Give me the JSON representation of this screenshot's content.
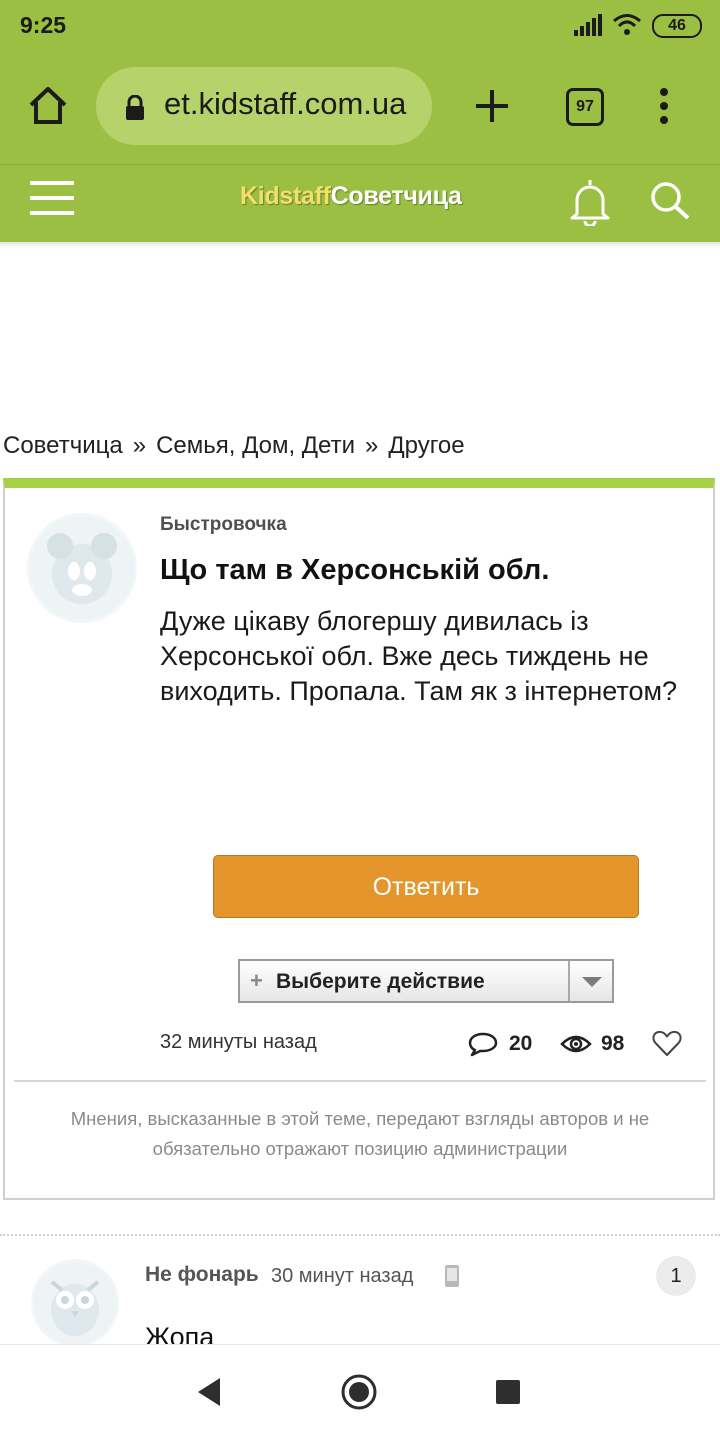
{
  "status_bar": {
    "time": "9:25",
    "battery": "46"
  },
  "browser": {
    "url": "et.kidstaff.com.ua",
    "tab_count": "97"
  },
  "site": {
    "logo_part1": "Kidstaff",
    "logo_part2": "Советчица"
  },
  "breadcrumb": {
    "items": [
      "Советчица",
      "Семья, Дом, Дети",
      "Другое"
    ],
    "separator": "»"
  },
  "topic": {
    "author": "Быстровочка",
    "title": "Що там в Херсонській обл.",
    "body": "Дуже цікаву блогершу дивилась із Херсонської обл. Вже десь тиждень не виходить. Пропала. Там як з інтернетом?",
    "reply_label": "Ответить",
    "action_plus": "+",
    "action_label": "Выберите действие",
    "time": "32 минуты назад",
    "comments": "20",
    "views": "98",
    "disclaimer": "Мнения, высказанные в этой теме, передают взгляды авторов и не обязательно отражают позицию администрации"
  },
  "comment": {
    "author": "Не фонарь",
    "time": "30 минут назад",
    "badge": "1",
    "text": "Жопа"
  },
  "colors": {
    "header_green": "#9bbf43",
    "accent_green": "#a6d147",
    "reply_orange": "#e4962c",
    "logo_yellow": "#f3df6a"
  },
  "icons": [
    "home-icon",
    "lock-icon",
    "plus-icon",
    "tabs-icon",
    "more-vert-icon",
    "hamburger-icon",
    "bell-icon",
    "search-icon",
    "comment-icon",
    "eye-icon",
    "heart-icon",
    "mobile-icon",
    "back-icon",
    "home-circle-icon",
    "recents-icon"
  ]
}
